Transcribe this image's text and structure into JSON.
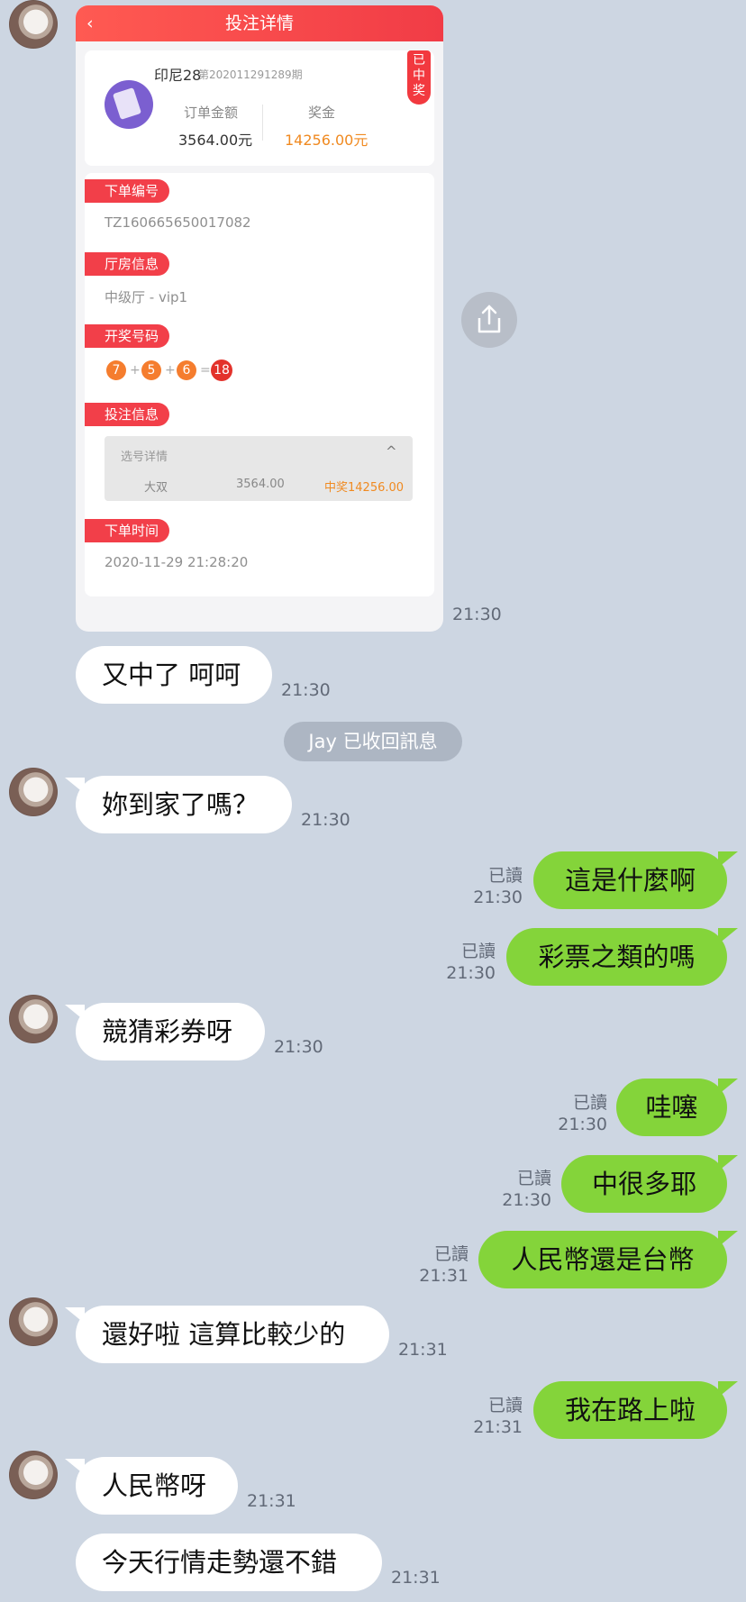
{
  "chat_time": "21:30",
  "screenshot": {
    "header_title": "投注详情",
    "back_icon": "‹",
    "lottery_name": "印尼28",
    "period": "第202011291289期",
    "badge": "已中奖",
    "order_amount_label": "订单金额",
    "order_amount": "3564.00元",
    "prize_label": "奖金",
    "prize": "14256.00元",
    "order_no_label": "下单编号",
    "order_no": "TZ160665650017082",
    "room_label": "厅房信息",
    "room": "中级厅 - vip1",
    "draw_label": "开奖号码",
    "draw": {
      "n1": "7",
      "n2": "5",
      "n3": "6",
      "total": "18",
      "plus": "+",
      "equals": "="
    },
    "bet_label": "投注信息",
    "bet_detail_header": "选号详情",
    "bet_choice": "大双",
    "bet_amount": "3564.00",
    "bet_win": "中奖14256.00",
    "time_label": "下单时间",
    "order_time": "2020-11-29 21:28:20"
  },
  "messages": [
    {
      "text": "又中了 呵呵",
      "time": "21:30"
    },
    {
      "text": "妳到家了嗎？",
      "time": "21:30"
    },
    {
      "text": "這是什麼啊",
      "read": "已讀",
      "time": "21:30"
    },
    {
      "text": "彩票之類的嗎",
      "read": "已讀",
      "time": "21:30"
    },
    {
      "text": "競猜彩券呀",
      "time": "21:30"
    },
    {
      "text": "哇噻",
      "read": "已讀",
      "time": "21:30"
    },
    {
      "text": "中很多耶",
      "read": "已讀",
      "time": "21:30"
    },
    {
      "text": "人民幣還是台幣",
      "read": "已讀",
      "time": "21:31"
    },
    {
      "text": "還好啦 這算比較少的",
      "time": "21:31"
    },
    {
      "text": "我在路上啦",
      "read": "已讀",
      "time": "21:31"
    },
    {
      "text": "人民幣呀",
      "time": "21:31"
    },
    {
      "text": "今天行情走勢還不錯",
      "time": "21:31"
    }
  ],
  "recall_notice": "Jay 已收回訊息",
  "colors": {
    "background": "#cdd6e2",
    "sent_bubble": "#84d43a",
    "received_bubble": "#ffffff",
    "accent_red": "#f23f49"
  },
  "icons": {
    "share": "share-icon",
    "back": "back-icon"
  }
}
